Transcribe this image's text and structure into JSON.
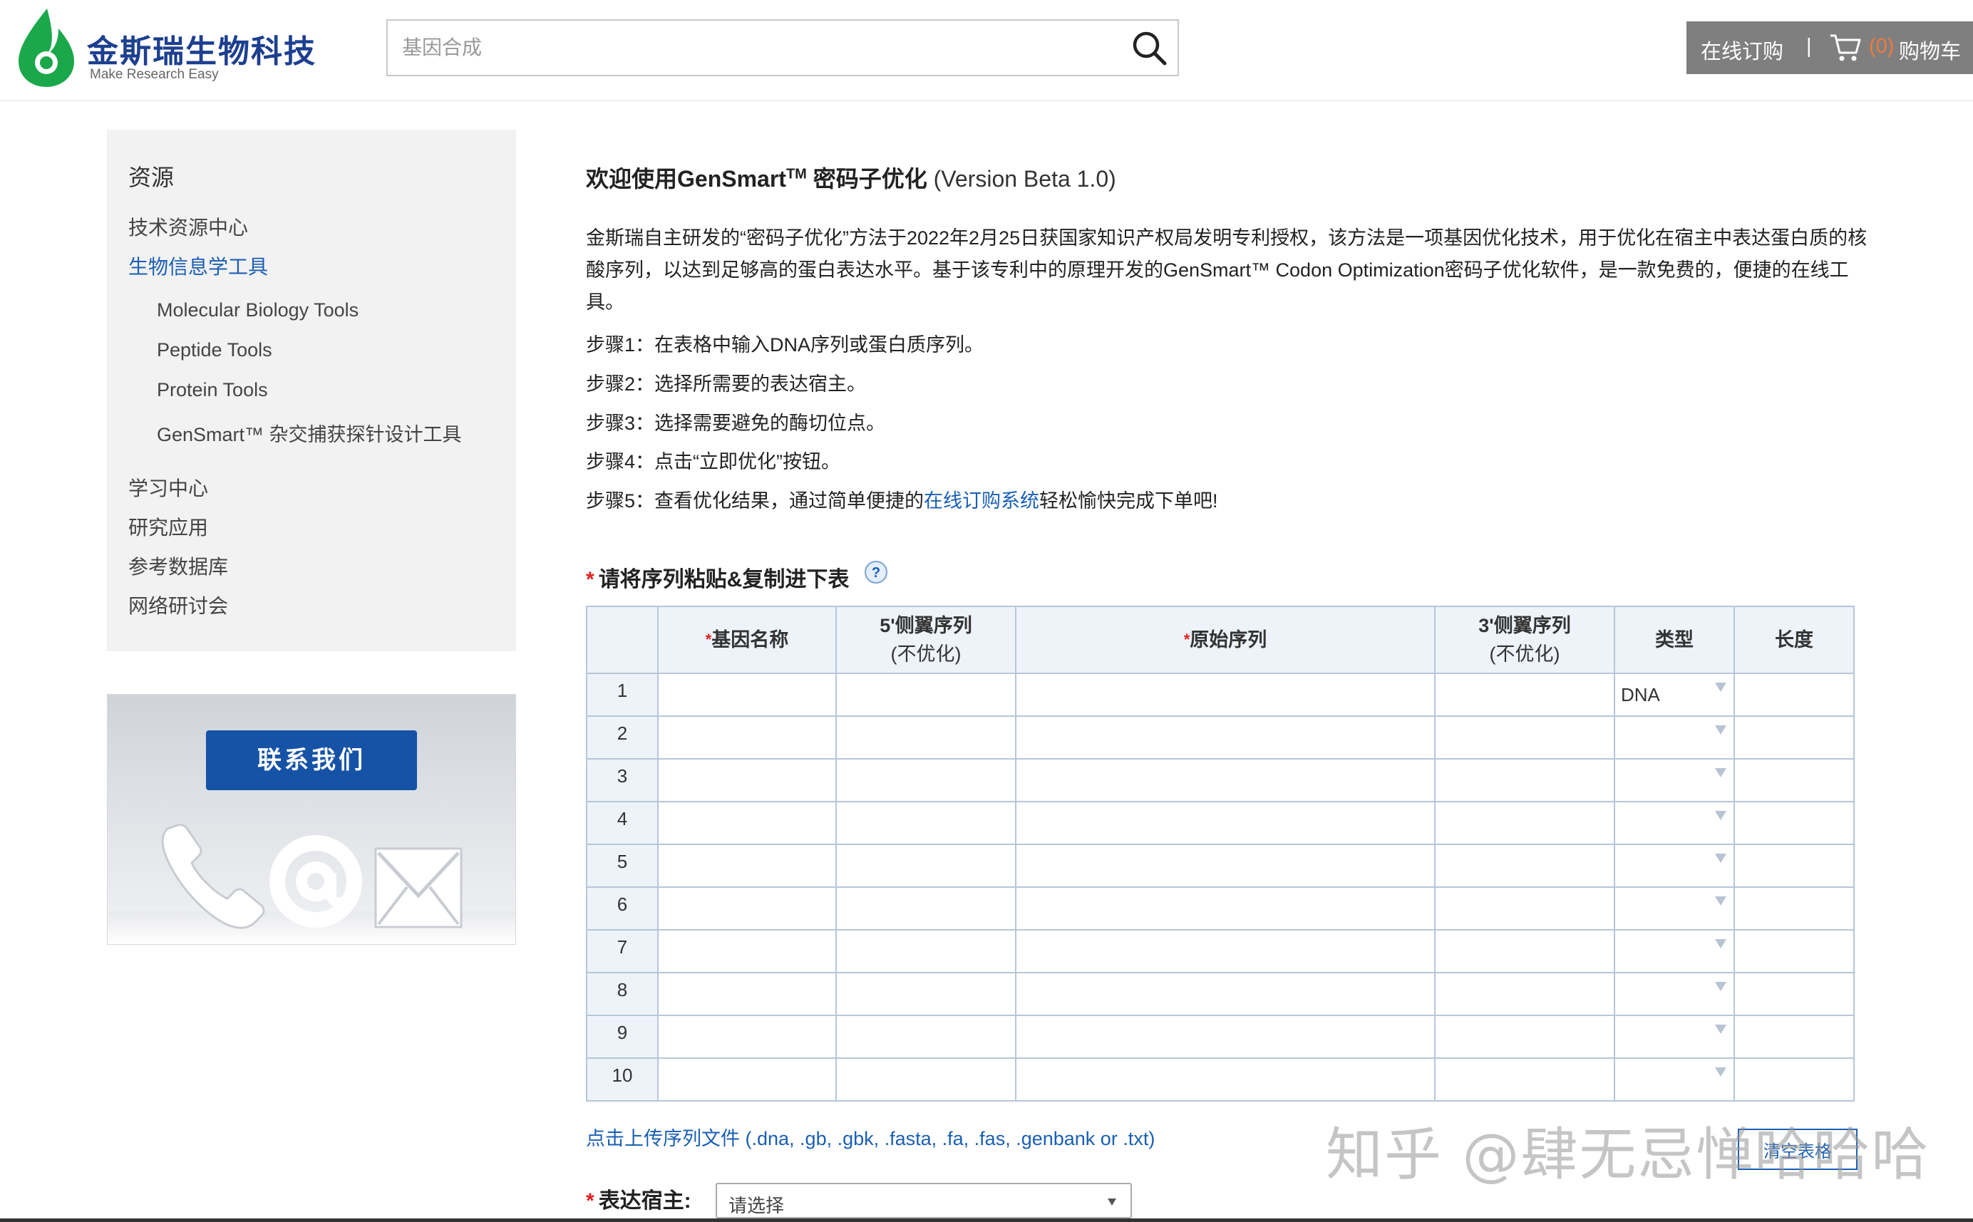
{
  "header": {
    "logo_cn": "金斯瑞生物科技",
    "logo_en": "Make Research Easy",
    "search_placeholder": "基因合成",
    "order_link": "在线订购",
    "separator": "|",
    "cart_count": "(0)",
    "cart_label": "购物车",
    "brand_color": "#1d3f8f",
    "logo_green": "#1aa84a"
  },
  "sidebar": {
    "title": "资源",
    "items": [
      {
        "label": "技术资源中心"
      },
      {
        "label": "生物信息学工具"
      },
      {
        "label": "学习中心"
      },
      {
        "label": "研究应用"
      },
      {
        "label": "参考数据库"
      },
      {
        "label": "网络研讨会"
      }
    ],
    "subitems": [
      {
        "label": "Molecular Biology Tools"
      },
      {
        "label": "Peptide Tools"
      },
      {
        "label": "Protein Tools"
      },
      {
        "label": "GenSmart™ 杂交捕获探针设计工具"
      }
    ],
    "contact_button": "联系我们"
  },
  "main": {
    "title_prefix": "欢迎使用GenSmart",
    "title_sup": "TM",
    "title_suffix": " 密码子优化 ",
    "title_version": "(Version Beta 1.0)",
    "intro": "金斯瑞自主研发的“密码子优化”方法于2022年2月25日获国家知识产权局发明专利授权，该方法是一项基因优化技术，用于优化在宿主中表达蛋白质的核酸序列，以达到足够高的蛋白表达水平。基于该专利中的原理开发的GenSmart™ Codon Optimization密码子优化软件，是一款免费的，便捷的在线工具。",
    "steps": [
      "步骤1：在表格中输入DNA序列或蛋白质序列。",
      "步骤2：选择所需要的表达宿主。",
      "步骤3：选择需要避免的酶切位点。",
      "步骤4：点击“立即优化”按钮。"
    ],
    "step5_prefix": "步骤5：查看优化结果，通过简单便捷的",
    "step5_link": "在线订购系统",
    "step5_suffix": "轻松愉快完成下单吧!",
    "section_label": "请将序列粘贴&复制进下表",
    "required_mark": "*",
    "table": {
      "headers": {
        "gene_name": "基因名称",
        "five_prime": "5'侧翼序列",
        "five_prime_sub": "(不优化)",
        "original_seq": "原始序列",
        "three_prime": "3'侧翼序列",
        "three_prime_sub": "(不优化)",
        "type": "类型",
        "length": "长度"
      },
      "rows": [
        {
          "num": "1",
          "type": "DNA"
        },
        {
          "num": "2",
          "type": ""
        },
        {
          "num": "3",
          "type": ""
        },
        {
          "num": "4",
          "type": ""
        },
        {
          "num": "5",
          "type": ""
        },
        {
          "num": "6",
          "type": ""
        },
        {
          "num": "7",
          "type": ""
        },
        {
          "num": "8",
          "type": ""
        },
        {
          "num": "9",
          "type": ""
        },
        {
          "num": "10",
          "type": ""
        }
      ]
    },
    "upload_link": "点击上传序列文件 (.dna, .gb, .gbk, .fasta, .fa, .fas, .genbank or .txt)",
    "clear_button": "清空表格",
    "host_label": "表达宿主:",
    "host_select": "请选择",
    "link_color": "#1a5fb4"
  },
  "watermark": "知乎 @肆无忌惮哈哈哈"
}
